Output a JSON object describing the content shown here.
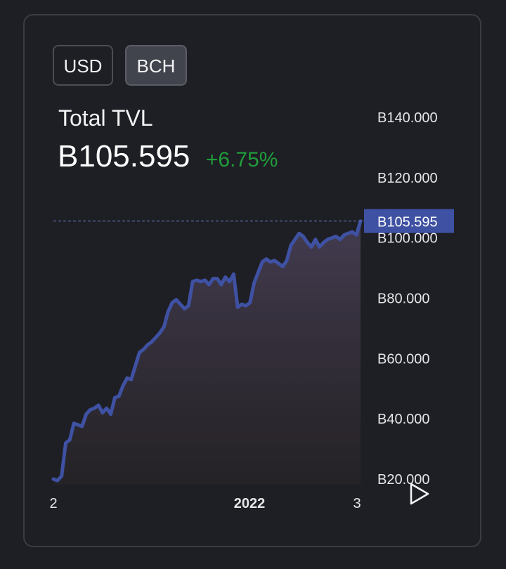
{
  "currency_toggle": {
    "usd_label": "USD",
    "bch_label": "BCH",
    "selected": "BCH"
  },
  "header": {
    "title": "Total TVL",
    "value": "B105.595",
    "change": "+6.75%",
    "change_color": "#1f9d3a"
  },
  "colors": {
    "line": "#3f51a3",
    "badge_bg": "#3f51a3",
    "crosshair": "#5a6aa8"
  },
  "play_icon": "play-icon",
  "chart_data": {
    "type": "area",
    "title": "",
    "xlabel": "",
    "ylabel": "",
    "ylim": [
      19000,
      140000
    ],
    "y_ticks": [
      "B140.000",
      "B120.000",
      "B100.000",
      "B80.000",
      "B60.000",
      "B40.000",
      "B20.000"
    ],
    "y_tick_values": [
      140000,
      120000,
      100000,
      80000,
      60000,
      40000,
      20000
    ],
    "x_ticks": [
      "2",
      "2022",
      "3"
    ],
    "current_value": 105595,
    "current_label": "B105.595",
    "series": [
      {
        "values": [
          20000,
          19500,
          21000,
          32000,
          33000,
          38500,
          38000,
          37500,
          41500,
          43000,
          43500,
          44500,
          42000,
          43500,
          41500,
          47000,
          47500,
          51000,
          53500,
          53000,
          57500,
          62000,
          63000,
          64500,
          65500,
          67000,
          68500,
          70500,
          75500,
          78500,
          79500,
          78000,
          76500,
          77500,
          85500,
          86000,
          85500,
          86000,
          84500,
          86500,
          86500,
          84500,
          87000,
          85500,
          88000,
          77000,
          78000,
          77500,
          78500,
          85000,
          88500,
          92000,
          93000,
          92000,
          92500,
          91500,
          90500,
          92500,
          97500,
          99500,
          101500,
          100500,
          98500,
          97000,
          99500,
          97000,
          98500,
          99500,
          100000,
          100500,
          99500,
          101000,
          101500,
          102000,
          101000,
          105595
        ]
      }
    ]
  }
}
